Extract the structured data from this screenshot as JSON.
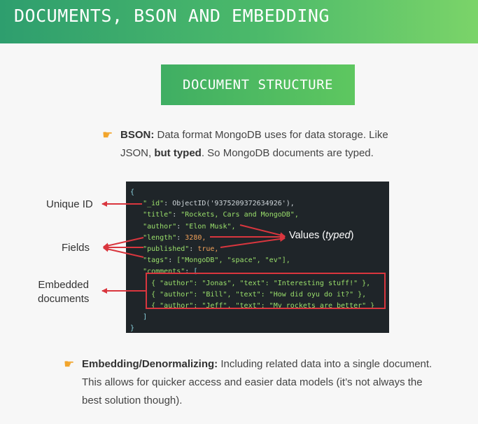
{
  "header": {
    "title": "DOCUMENTS, BSON AND EMBEDDING"
  },
  "badge": {
    "label": "DOCUMENT STRUCTURE"
  },
  "bson": {
    "term": "BSON:",
    "line1_rest": " Data format MongoDB uses for data storage. Like",
    "line2_a": "JSON, ",
    "line2_bold": "but typed",
    "line2_b": ". So MongoDB documents are typed."
  },
  "code": {
    "open": "{",
    "id_key": "\"_id\"",
    "id_val": "ObjectID('9375209372634926'),",
    "title_key": "\"title\"",
    "title_val": "\"Rockets, Cars and MongoDB\",",
    "author_key": "\"author\"",
    "author_val": "\"Elon Musk\",",
    "length_key": "\"length\"",
    "length_val": "3280,",
    "published_key": "\"published\"",
    "published_val": "true,",
    "tags_key": "\"tags\"",
    "tags_val": "[\"MongoDB\", \"space\", \"ev\"],",
    "comments_key": "\"comments\"",
    "comments_open": "[",
    "c1": "{ \"author\": \"Jonas\", \"text\": \"Interesting stuff!\" },",
    "c2": "{ \"author\": \"Bill\", \"text\": \"How did oyu do it?\" },",
    "c3": "{ \"author\": \"Jeff\", \"text\": \"My rockets are better\" }",
    "comments_close": "]",
    "close": "}"
  },
  "labels": {
    "unique_id": "Unique ID",
    "fields": "Fields",
    "embedded_line1": "Embedded",
    "embedded_line2": "documents",
    "values_prefix": "Values (",
    "values_italic": "typed",
    "values_suffix": ")"
  },
  "embedding": {
    "term": "Embedding/Denormalizing:",
    "line1_rest": " Including related data into a single document.",
    "line2": "This allows for quicker access and easier data models (it’s not always the",
    "line3": "best solution though)."
  },
  "colors": {
    "accent": "#4cba6a",
    "arrow": "#d9363e",
    "code_bg": "#1f2529"
  }
}
